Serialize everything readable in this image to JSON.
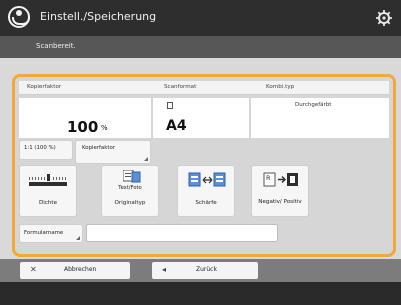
{
  "title": "Einstell./Speicherung",
  "status": "Scanbereit.",
  "info": {
    "zoom_label": "Kopierfaktor",
    "paper_label": "Scanformat",
    "combo_label": "Kombi.typ",
    "zoom_value": "100",
    "zoom_unit": "%",
    "paper_value": "A4",
    "combo_value": "Durchgefärbt"
  },
  "ratio_button": "1:1 (100 %)",
  "zoom_button": "Kopierfaktor",
  "functions": [
    {
      "label": "Dichte"
    },
    {
      "label": "Originaltyp",
      "icon_text": "Text/Foto"
    },
    {
      "label": "Schärfe"
    },
    {
      "label": "Negativ/ Positiv",
      "icon_text": "R"
    }
  ],
  "file_name_button": "Formularname",
  "file_name_value": "",
  "bottom": {
    "cancel": "Abbrechen",
    "back": "Zurück"
  },
  "colors": {
    "accent": "#f2a93a",
    "titlebar": "#2e2e2e",
    "statusbar": "#575757",
    "bottombar": "#7c7c7c"
  }
}
